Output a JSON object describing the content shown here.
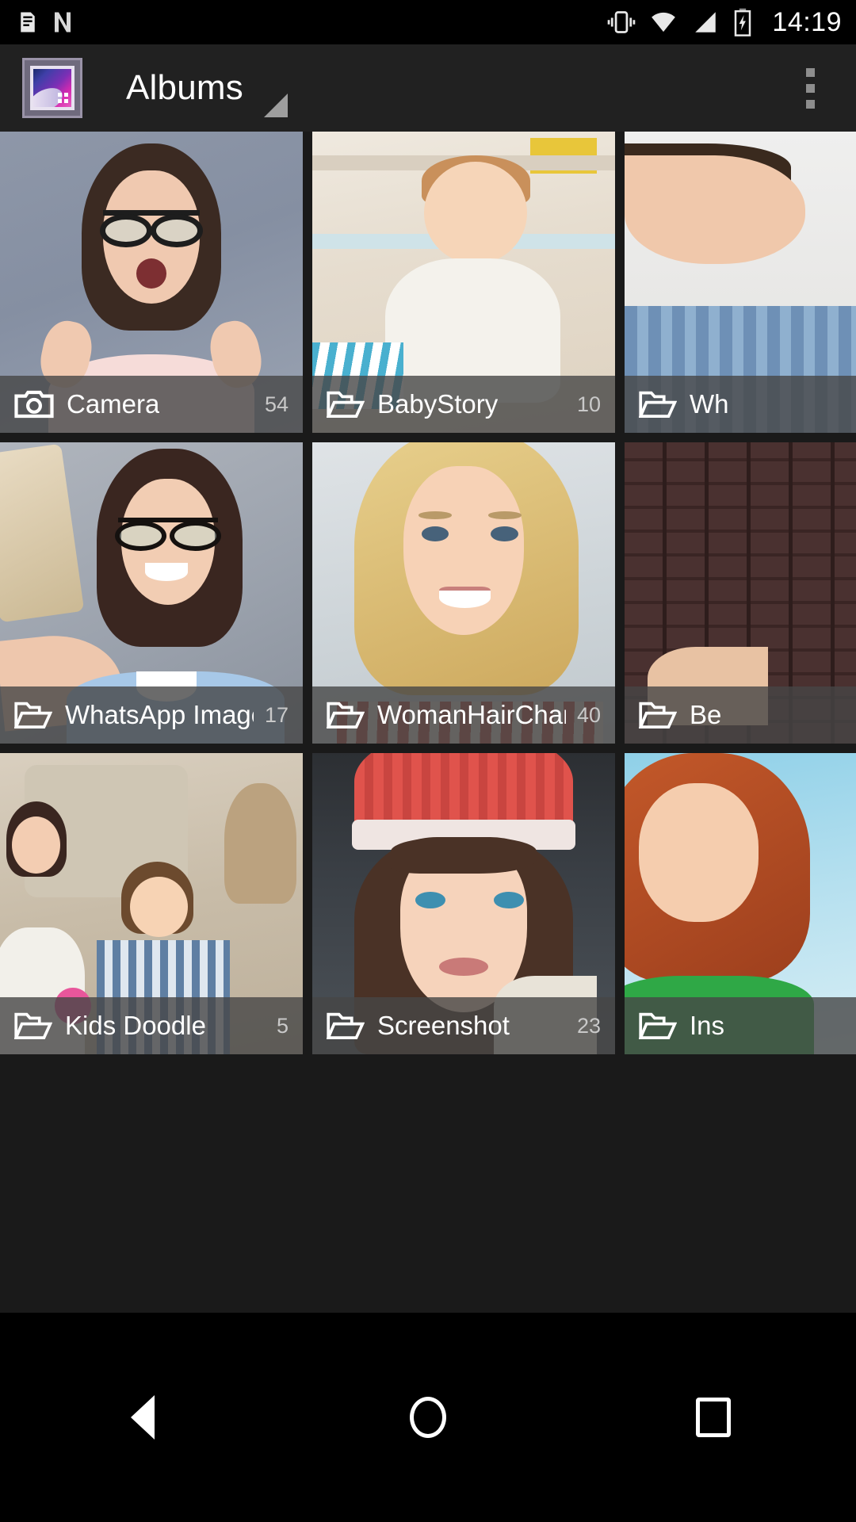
{
  "status_bar": {
    "time": "14:19",
    "icons_left": [
      "notification-list-icon",
      "netflix-n-icon"
    ],
    "icons_right": [
      "vibrate-icon",
      "wifi-icon",
      "cellular-signal-icon",
      "battery-charging-icon"
    ]
  },
  "app_bar": {
    "title": "Albums",
    "app_icon": "gallery-app-icon",
    "dropdown_indicator": "view-mode-triangle",
    "overflow_menu": "more-options-icon"
  },
  "colors": {
    "status_bar_bg": "#000000",
    "app_bar_bg": "#212121",
    "grid_bg": "#1a1a1a",
    "tile_label_bg": "rgba(70,70,70,0.80)",
    "label_text": "#ffffff",
    "count_text": "#c9c9c9",
    "nav_bar_bg": "#000000"
  },
  "albums": [
    {
      "name": "Camera",
      "count": "54",
      "icon": "camera-icon",
      "photo": "p1",
      "partial": false
    },
    {
      "name": "BabyStory",
      "count": "10",
      "icon": "folder-icon",
      "photo": "p2",
      "partial": false
    },
    {
      "name": "Wh",
      "count": "",
      "icon": "folder-icon",
      "photo": "p3",
      "partial": true
    },
    {
      "name": "WhatsApp Images",
      "count": "17",
      "icon": "folder-icon",
      "photo": "p4",
      "partial": false
    },
    {
      "name": "WomanHairChanger",
      "count": "40",
      "icon": "folder-icon",
      "photo": "p5",
      "partial": false
    },
    {
      "name": "Be",
      "count": "",
      "icon": "folder-icon",
      "photo": "p6",
      "partial": true
    },
    {
      "name": "Kids Doodle",
      "count": "5",
      "icon": "folder-icon",
      "photo": "p7",
      "partial": false
    },
    {
      "name": "Screenshot",
      "count": "23",
      "icon": "folder-icon",
      "photo": "p8",
      "partial": false
    },
    {
      "name": "Ins",
      "count": "",
      "icon": "folder-icon",
      "photo": "p9",
      "partial": true
    }
  ],
  "nav_bar": {
    "back": "back-button",
    "home": "home-button",
    "recents": "recents-button"
  }
}
